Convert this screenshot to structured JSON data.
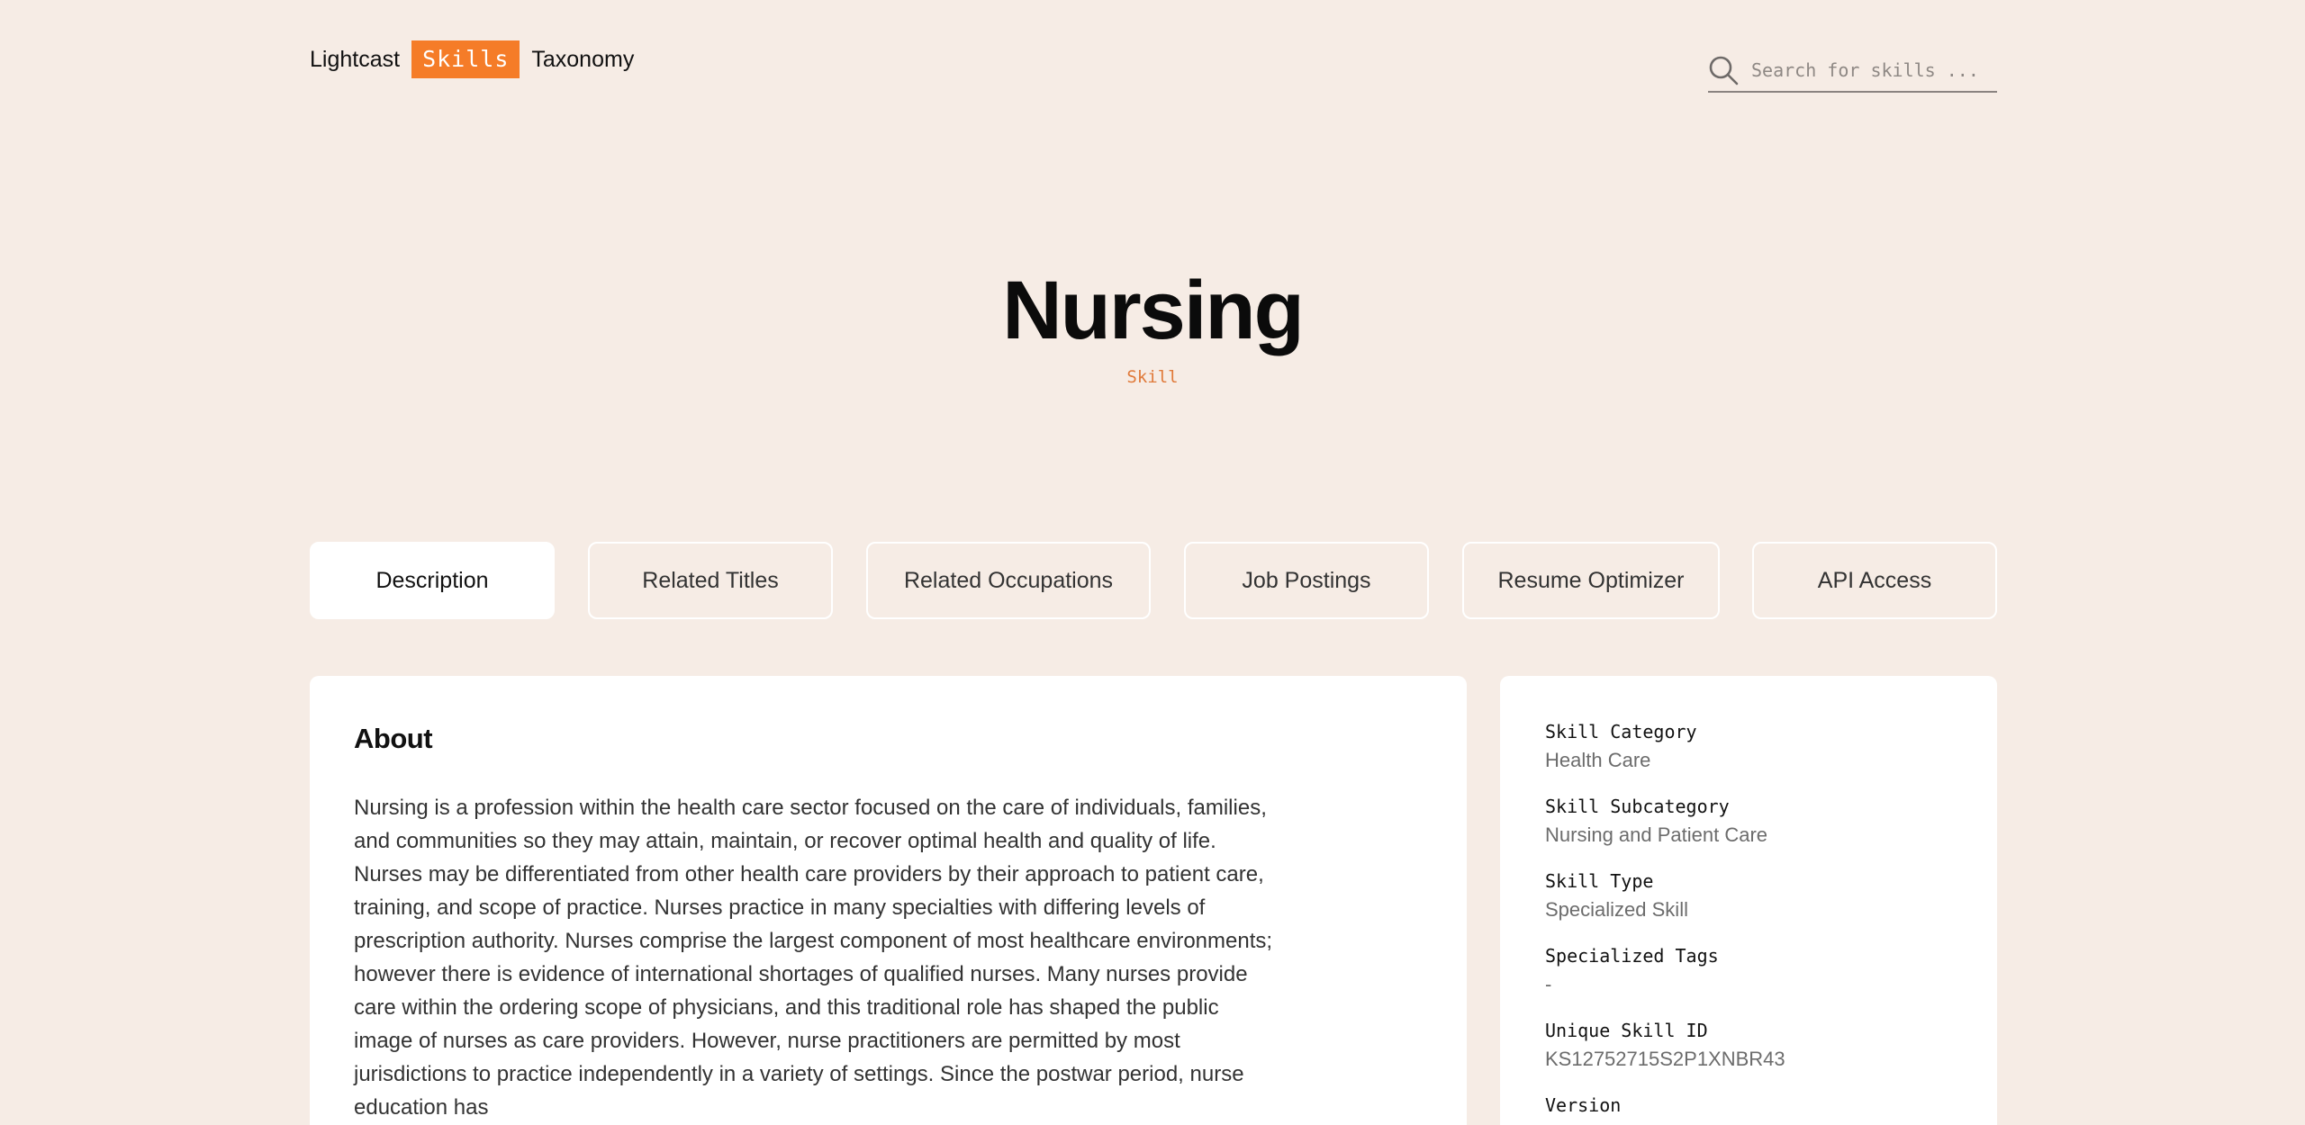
{
  "header": {
    "logo_left": "Lightcast",
    "logo_mid": "Skills",
    "logo_right": "Taxonomy",
    "search_placeholder": "Search for skills ..."
  },
  "hero": {
    "title": "Nursing",
    "subtitle": "Skill"
  },
  "tabs": [
    {
      "label": "Description",
      "active": true
    },
    {
      "label": "Related Titles",
      "active": false
    },
    {
      "label": "Related Occupations",
      "active": false
    },
    {
      "label": "Job Postings",
      "active": false
    },
    {
      "label": "Resume Optimizer",
      "active": false
    },
    {
      "label": "API Access",
      "active": false
    }
  ],
  "about": {
    "heading": "About",
    "text": "Nursing is a profession within the health care sector focused on the care of individuals, families, and communities so they may attain, maintain, or recover optimal health and quality of life. Nurses may be differentiated from other health care providers by their approach to patient care, training, and scope of practice. Nurses practice in many specialties with differing levels of prescription authority. Nurses comprise the largest component of most healthcare environments; however there is evidence of international shortages of qualified nurses. Many nurses provide care within the ordering scope of physicians, and this traditional role has shaped the public image of nurses as care providers. However, nurse practitioners are permitted by most jurisdictions to practice independently in a variety of settings. Since the postwar period, nurse education has"
  },
  "meta": {
    "items": [
      {
        "label": "Skill Category",
        "value": "Health Care"
      },
      {
        "label": "Skill Subcategory",
        "value": "Nursing and Patient Care"
      },
      {
        "label": "Skill Type",
        "value": "Specialized Skill"
      },
      {
        "label": "Specialized Tags",
        "value": "-"
      },
      {
        "label": "Unique Skill ID",
        "value": "KS12752715S2P1XNBR43"
      },
      {
        "label": "Version",
        "value": ""
      }
    ]
  },
  "colors": {
    "background": "#f6ece5",
    "accent": "#f57c28",
    "subtitle": "#e07a3a",
    "card": "#ffffff"
  }
}
